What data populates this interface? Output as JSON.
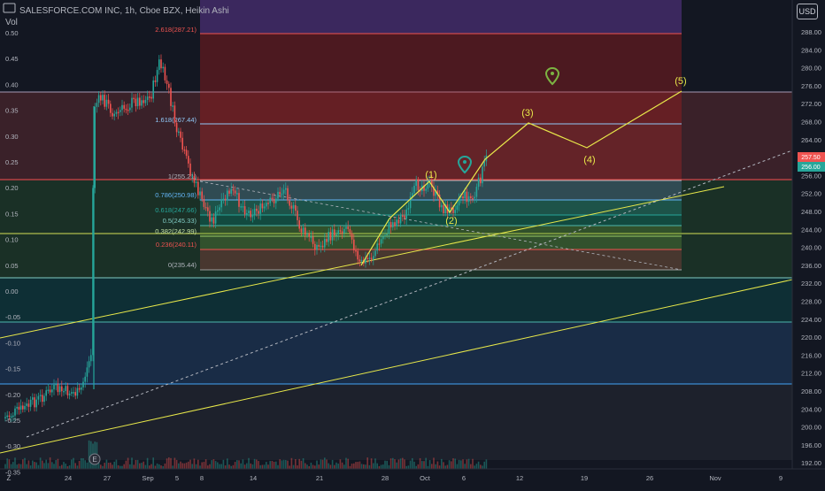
{
  "header": {
    "symbol_line": "SALESFORCE.COM INC, 1h, Cboe BZX, Heikin Ashi",
    "vol_label": "Vol"
  },
  "currency_button": "USD",
  "left_axis": [
    "0.50",
    "0.45",
    "0.40",
    "0.35",
    "0.30",
    "0.25",
    "0.20",
    "0.15",
    "0.10",
    "0.05",
    "0.00",
    "-0.05",
    "-0.10",
    "-0.15",
    "-0.20",
    "-0.25",
    "-0.30",
    "-0.35"
  ],
  "right_axis": [
    "288.00",
    "284.00",
    "280.00",
    "276.00",
    "272.00",
    "268.00",
    "264.00",
    "260.00",
    "256.00",
    "252.00",
    "248.00",
    "244.00",
    "240.00",
    "236.00",
    "232.00",
    "228.00",
    "224.00",
    "220.00",
    "216.00",
    "212.00",
    "208.00",
    "204.00",
    "200.00",
    "196.00",
    "192.00"
  ],
  "x_axis": [
    "24",
    "27",
    "Sep",
    "5",
    "8",
    "14",
    "21",
    "28",
    "Oct",
    "6",
    "12",
    "19",
    "26",
    "Nov",
    "9"
  ],
  "fib_labels": [
    "2.618(287.21)",
    "1.618(267.44)",
    "1(255.21)",
    "0.786(250.98)",
    "0.618(247.66)",
    "0.5(245.33)",
    "0.382(242.99)",
    "0.236(240.11)",
    "0(235.44)"
  ],
  "wave_labels": [
    "(1)",
    "(2)",
    "(3)",
    "(4)",
    "(5)"
  ],
  "price_tags": [
    "257.50",
    "256.00"
  ],
  "colors": {
    "background": "#131722",
    "bull": "#26a69a",
    "bear": "#ef5350",
    "wave": "#e8e84a",
    "fib_top": "#4a2f73"
  },
  "icons": [
    "tradingview-logo-icon",
    "z-zoom-icon",
    "e-earnings-icon",
    "map-pin-icon"
  ]
}
